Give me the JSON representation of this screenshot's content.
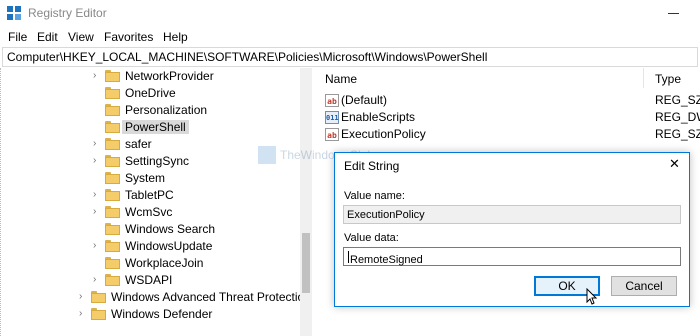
{
  "window": {
    "title": "Registry Editor"
  },
  "menu": [
    "File",
    "Edit",
    "View",
    "Favorites",
    "Help"
  ],
  "address": "Computer\\HKEY_LOCAL_MACHINE\\SOFTWARE\\Policies\\Microsoft\\Windows\\PowerShell",
  "tree": {
    "items": [
      {
        "label": "NetworkProvider",
        "expandable": true
      },
      {
        "label": "OneDrive",
        "expandable": false
      },
      {
        "label": "Personalization",
        "expandable": false
      },
      {
        "label": "PowerShell",
        "expandable": false,
        "selected": true
      },
      {
        "label": "safer",
        "expandable": true
      },
      {
        "label": "SettingSync",
        "expandable": true
      },
      {
        "label": "System",
        "expandable": false
      },
      {
        "label": "TabletPC",
        "expandable": true
      },
      {
        "label": "WcmSvc",
        "expandable": true
      },
      {
        "label": "Windows Search",
        "expandable": false
      },
      {
        "label": "WindowsUpdate",
        "expandable": true
      },
      {
        "label": "WorkplaceJoin",
        "expandable": false
      },
      {
        "label": "WSDAPI",
        "expandable": true
      }
    ],
    "top_items": [
      {
        "label": "Windows Advanced Threat Protection",
        "expandable": true
      },
      {
        "label": "Windows Defender",
        "expandable": true
      }
    ]
  },
  "values": {
    "headers": {
      "name": "Name",
      "type": "Type"
    },
    "rows": [
      {
        "icon": "string-value-icon",
        "badge": "ab",
        "name": "(Default)",
        "type": "REG_SZ"
      },
      {
        "icon": "dword-value-icon",
        "badge": "011 110",
        "name": "EnableScripts",
        "type": "REG_DWO"
      },
      {
        "icon": "string-value-icon",
        "badge": "ab",
        "name": "ExecutionPolicy",
        "type": "REG_SZ"
      }
    ]
  },
  "watermark": "TheWindowsClub",
  "dialog": {
    "title": "Edit String",
    "close": "✕",
    "value_name_label": "Value name:",
    "value_name": "ExecutionPolicy",
    "value_data_label": "Value data:",
    "value_data": "RemoteSigned",
    "ok_label": "OK",
    "cancel_label": "Cancel"
  },
  "colors": {
    "accent": "#0078d7",
    "folder": "#f4cd6a",
    "selection": "#d9d9d9"
  }
}
